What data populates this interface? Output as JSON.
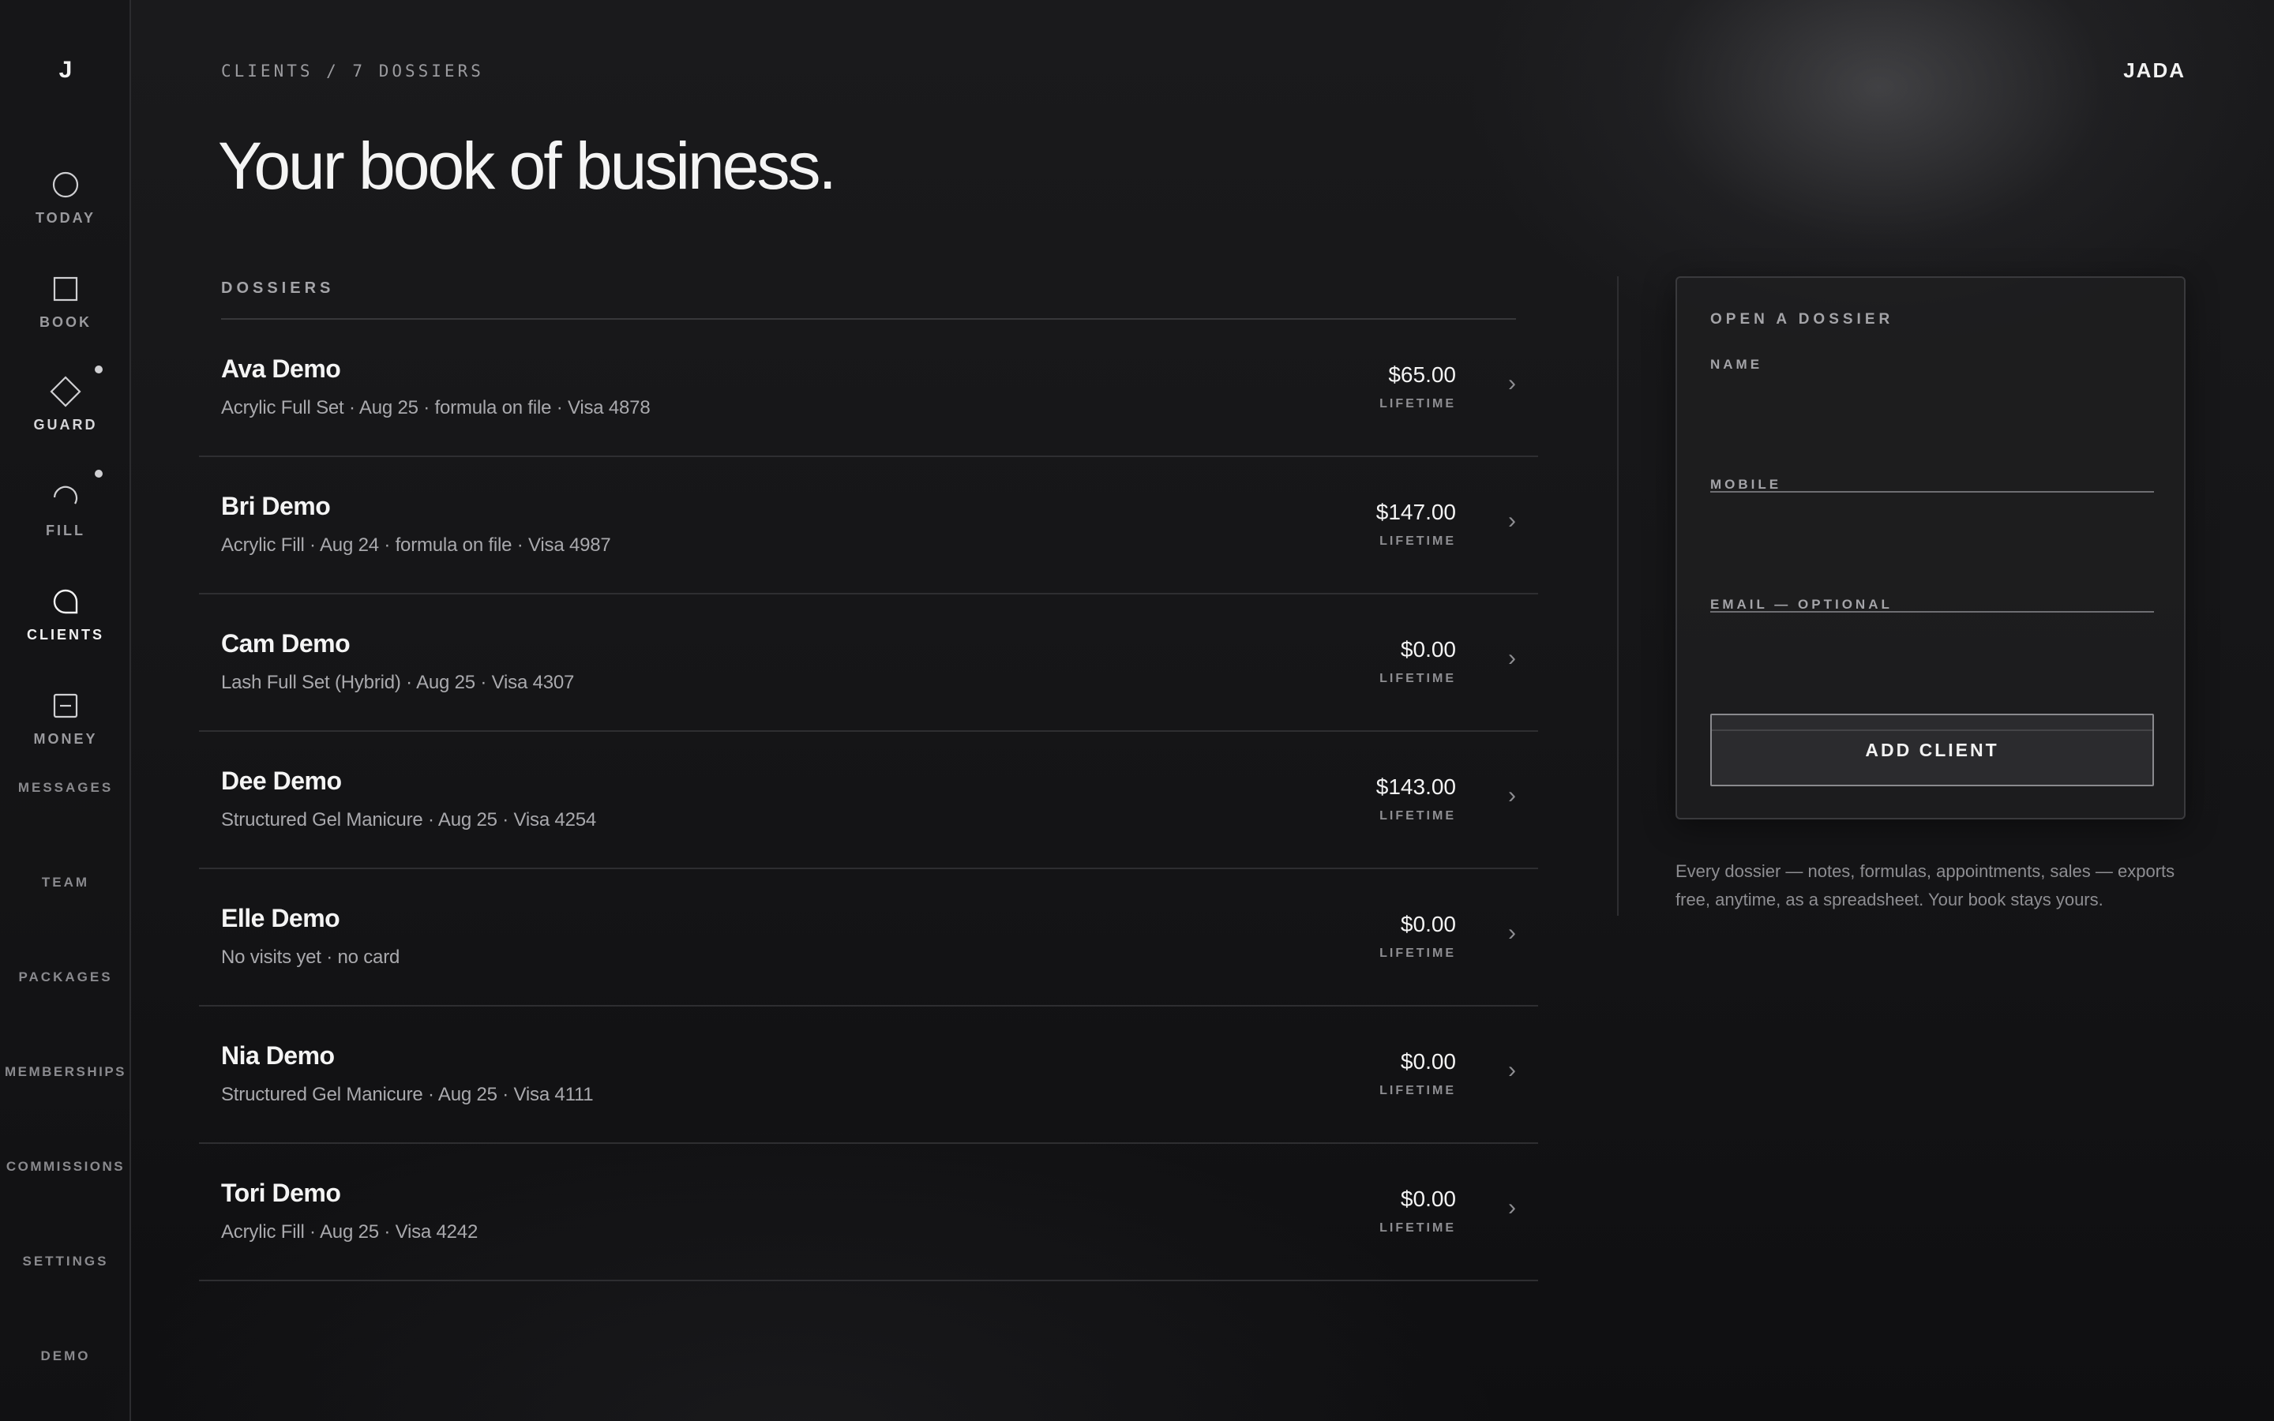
{
  "sidebar": {
    "logo": "J",
    "nav": [
      {
        "label": "TODAY",
        "icon": "circle-icon"
      },
      {
        "label": "BOOK",
        "icon": "square-icon"
      },
      {
        "label": "GUARD",
        "icon": "diamond-icon"
      },
      {
        "label": "FILL",
        "icon": "arc-icon"
      },
      {
        "label": "CLIENTS",
        "icon": "speech-bubble-icon"
      },
      {
        "label": "MONEY",
        "icon": "minus-box-icon"
      }
    ],
    "links": [
      "MESSAGES",
      "TEAM",
      "PACKAGES",
      "MEMBERSHIPS",
      "COMMISSIONS",
      "SETTINGS",
      "DEMO"
    ]
  },
  "header": {
    "breadcrumb": "CLIENTS / 7 DOSSIERS",
    "brand": "JADA",
    "title": "Your book of business."
  },
  "dossiers": {
    "heading": "DOSSIERS",
    "lifetime_label": "LIFETIME",
    "rows": [
      {
        "name": "Ava Demo",
        "meta": "Acrylic Full Set · Aug 25 · formula on file · Visa 4878",
        "amount": "$65.00"
      },
      {
        "name": "Bri Demo",
        "meta": "Acrylic Fill · Aug 24 · formula on file · Visa 4987",
        "amount": "$147.00"
      },
      {
        "name": "Cam Demo",
        "meta": "Lash Full Set (Hybrid) · Aug 25 · Visa 4307",
        "amount": "$0.00"
      },
      {
        "name": "Dee Demo",
        "meta": "Structured Gel Manicure · Aug 25 · Visa 4254",
        "amount": "$143.00"
      },
      {
        "name": "Elle Demo",
        "meta": "No visits yet · no card",
        "amount": "$0.00"
      },
      {
        "name": "Nia Demo",
        "meta": "Structured Gel Manicure · Aug 25 · Visa 4111",
        "amount": "$0.00"
      },
      {
        "name": "Tori Demo",
        "meta": "Acrylic Fill · Aug 25 · Visa 4242",
        "amount": "$0.00"
      }
    ]
  },
  "form": {
    "title": "OPEN A DOSSIER",
    "name_label": "NAME",
    "name_value": "",
    "mobile_label": "MOBILE",
    "mobile_value": "",
    "email_label": "EMAIL — OPTIONAL",
    "email_value": "",
    "submit_label": "ADD CLIENT"
  },
  "footnote": "Every dossier — notes, formulas, appointments, sales — exports free, anytime, as a spreadsheet. Your book stays yours.",
  "colors": {
    "background": "#141416",
    "text": "#ededed",
    "muted": "#9a9a9e",
    "divider": "#2e2e31"
  }
}
